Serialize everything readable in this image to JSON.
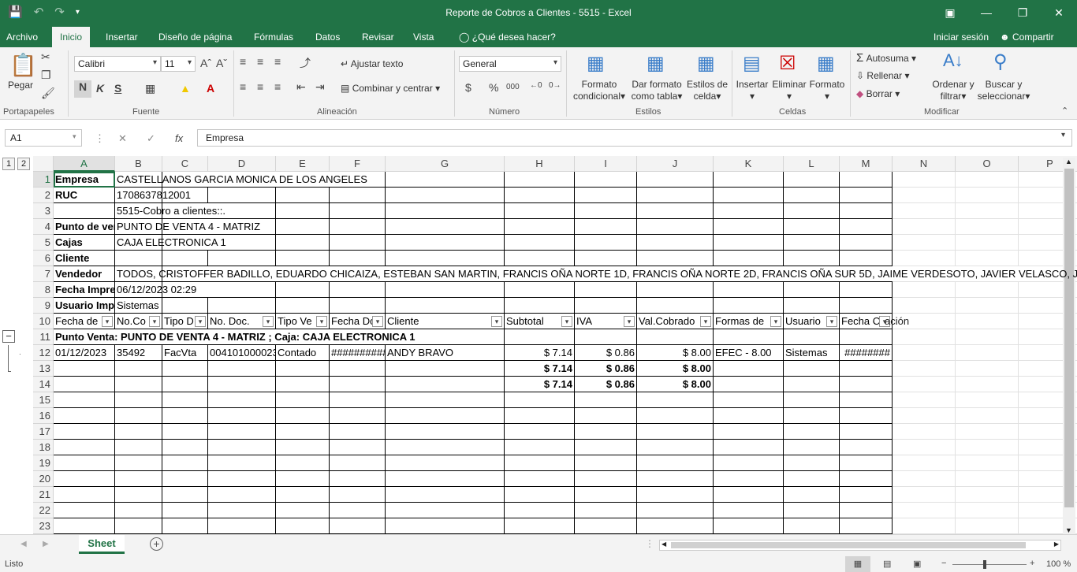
{
  "window": {
    "title": "Reporte de Cobros a Clientes - 5515 - Excel"
  },
  "menu": {
    "tabs": [
      "Archivo",
      "Inicio",
      "Insertar",
      "Diseño de página",
      "Fórmulas",
      "Datos",
      "Revisar",
      "Vista"
    ],
    "tell_me": "¿Qué desea hacer?",
    "sign_in": "Iniciar sesión",
    "share": "Compartir"
  },
  "ribbon": {
    "clipboard": {
      "paste": "Pegar",
      "group": "Portapapeles"
    },
    "font": {
      "name": "Calibri",
      "size": "11",
      "bold": "N",
      "italic": "K",
      "underline": "S",
      "group": "Fuente"
    },
    "alignment": {
      "wrap": "Ajustar texto",
      "merge": "Combinar y centrar",
      "group": "Alineación"
    },
    "number": {
      "format": "General",
      "group": "Número"
    },
    "styles": {
      "cond1": "Formato",
      "cond2": "condicional",
      "table1": "Dar formato",
      "table2": "como tabla",
      "cell1": "Estilos de",
      "cell2": "celda",
      "group": "Estilos"
    },
    "cells": {
      "insert": "Insertar",
      "delete": "Eliminar",
      "format": "Formato",
      "group": "Celdas"
    },
    "editing": {
      "autosum": "Autosuma",
      "fill": "Rellenar",
      "clear": "Borrar",
      "sort1": "Ordenar y",
      "sort2": "filtrar",
      "find1": "Buscar y",
      "find2": "seleccionar",
      "group": "Modificar"
    }
  },
  "formula_bar": {
    "name_box": "A1",
    "content": "Empresa"
  },
  "sheet": {
    "columns": [
      "A",
      "B",
      "C",
      "D",
      "E",
      "F",
      "G",
      "H",
      "I",
      "J",
      "K",
      "L",
      "M",
      "N",
      "O",
      "P"
    ],
    "rows": [
      "1",
      "2",
      "3",
      "4",
      "5",
      "6",
      "7",
      "8",
      "9",
      "10",
      "11",
      "12",
      "13",
      "14",
      "15",
      "16",
      "17",
      "18",
      "19",
      "20",
      "21",
      "22",
      "23"
    ],
    "r1": {
      "a": "Empresa",
      "b": "CASTELLANOS GARCIA MONICA DE LOS ANGELES"
    },
    "r2": {
      "a": "RUC",
      "b": "1708637812001"
    },
    "r3": {
      "b": "5515-Cobro a clientes::."
    },
    "r4": {
      "a": "Punto de venta",
      "b": "PUNTO DE VENTA 4 - MATRIZ"
    },
    "r5": {
      "a": "Cajas",
      "b": "CAJA ELECTRONICA 1"
    },
    "r6": {
      "a": "Cliente"
    },
    "r7": {
      "a": "Vendedor",
      "b": "TODOS, CRISTOFFER BADILLO, EDUARDO CHICAIZA, ESTEBAN SAN MARTIN, FRANCIS OÑA NORTE 1D, FRANCIS OÑA NORTE 2D, FRANCIS OÑA SUR 5D, JAIME VERDESOTO, JAVIER VELASCO, JAVIER VE"
    },
    "r8": {
      "a": "Fecha Impresión",
      "b": "06/12/2023 02:29"
    },
    "r9": {
      "a": "Usuario Impresión",
      "b": "Sistemas"
    },
    "r10": {
      "a": "Fecha de",
      "b": "No.Co",
      "c": "Tipo D",
      "d": "No. Doc.",
      "e": "Tipo Ve",
      "f": "Fecha Do",
      "g": "Cliente",
      "h": "Subtotal",
      "i": "IVA",
      "j": "Val.Cobrado",
      "k": "Formas de",
      "l": "Usuario",
      "m": "Fecha C",
      "m2": "ación"
    },
    "r11": {
      "a": "Punto Venta: PUNTO DE VENTA 4 - MATRIZ ; Caja: CAJA ELECTRONICA 1"
    },
    "r12": {
      "a": "01/12/2023",
      "b": "35492",
      "c": "FacVta",
      "d": "004101000023",
      "e": "Contado",
      "f": "##########",
      "g": "ANDY BRAVO",
      "h": "$ 7.14",
      "i": "$ 0.86",
      "j": "$ 8.00",
      "k": "EFEC - 8.00",
      "l": "Sistemas",
      "m": "########"
    },
    "r13": {
      "h": "$ 7.14",
      "i": "$ 0.86",
      "j": "$ 8.00"
    },
    "r14": {
      "h": "$ 7.14",
      "i": "$ 0.86",
      "j": "$ 8.00"
    }
  },
  "sheet_tab": "Sheet",
  "status": {
    "ready": "Listo",
    "zoom": "100 %"
  }
}
